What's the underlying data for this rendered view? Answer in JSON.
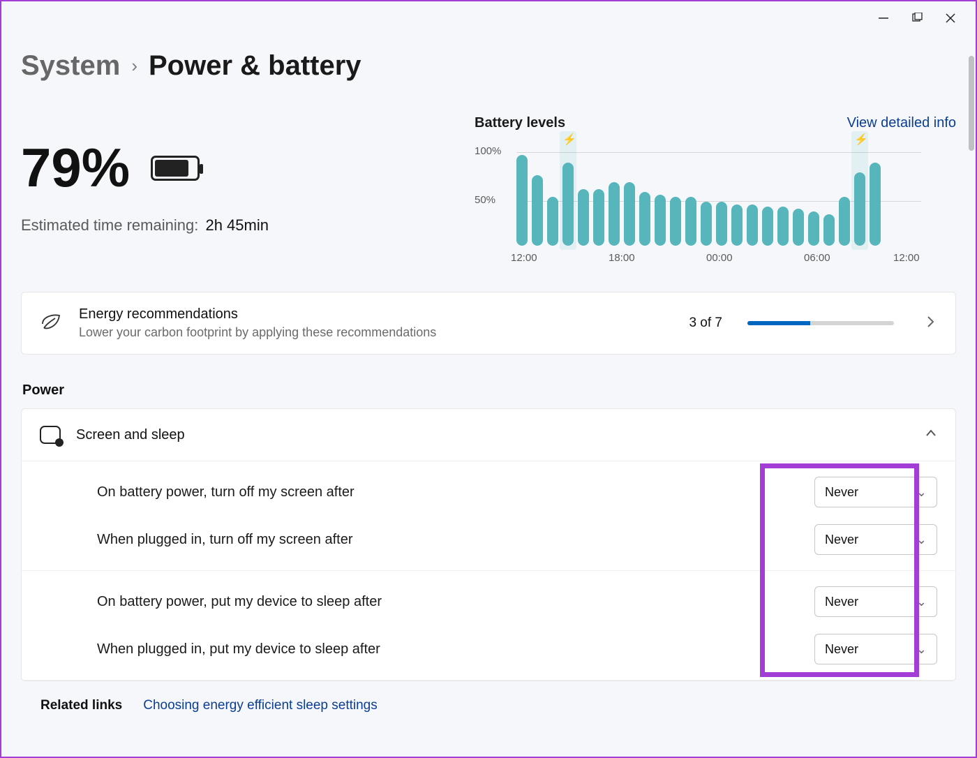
{
  "breadcrumb": {
    "parent": "System",
    "current": "Power & battery"
  },
  "battery": {
    "percent": "79%",
    "est_label": "Estimated time remaining:",
    "est_value": "2h 45min"
  },
  "chart_head": {
    "title": "Battery levels",
    "link": "View detailed info"
  },
  "chart_data": {
    "type": "bar",
    "title": "Battery levels",
    "ylabel": "",
    "xlabel": "",
    "ylim": [
      0,
      100
    ],
    "y_ticks": [
      "100%",
      "50%"
    ],
    "x_ticks": [
      "12:00",
      "18:00",
      "00:00",
      "06:00",
      "12:00"
    ],
    "charging_at_index": [
      3,
      22
    ],
    "categories": [
      "12:00",
      "13:00",
      "14:00",
      "15:00",
      "16:00",
      "17:00",
      "18:00",
      "19:00",
      "20:00",
      "21:00",
      "22:00",
      "23:00",
      "00:00",
      "01:00",
      "02:00",
      "03:00",
      "04:00",
      "05:00",
      "06:00",
      "07:00",
      "08:00",
      "09:00",
      "10:00",
      "11:00"
    ],
    "values": [
      93,
      72,
      50,
      85,
      58,
      58,
      65,
      65,
      55,
      52,
      50,
      50,
      45,
      45,
      42,
      42,
      40,
      40,
      38,
      35,
      32,
      50,
      75,
      85
    ]
  },
  "energy": {
    "title": "Energy recommendations",
    "subtitle": "Lower your carbon footprint by applying these recommendations",
    "count": "3 of 7",
    "progress_pct": 43
  },
  "section": {
    "power": "Power"
  },
  "sleep": {
    "header": "Screen and sleep",
    "rows": [
      {
        "label": "On battery power, turn off my screen after",
        "value": "Never"
      },
      {
        "label": "When plugged in, turn off my screen after",
        "value": "Never"
      },
      {
        "label": "On battery power, put my device to sleep after",
        "value": "Never"
      },
      {
        "label": "When plugged in, put my device to sleep after",
        "value": "Never"
      }
    ]
  },
  "related": {
    "label": "Related links",
    "link": "Choosing energy efficient sleep settings"
  }
}
